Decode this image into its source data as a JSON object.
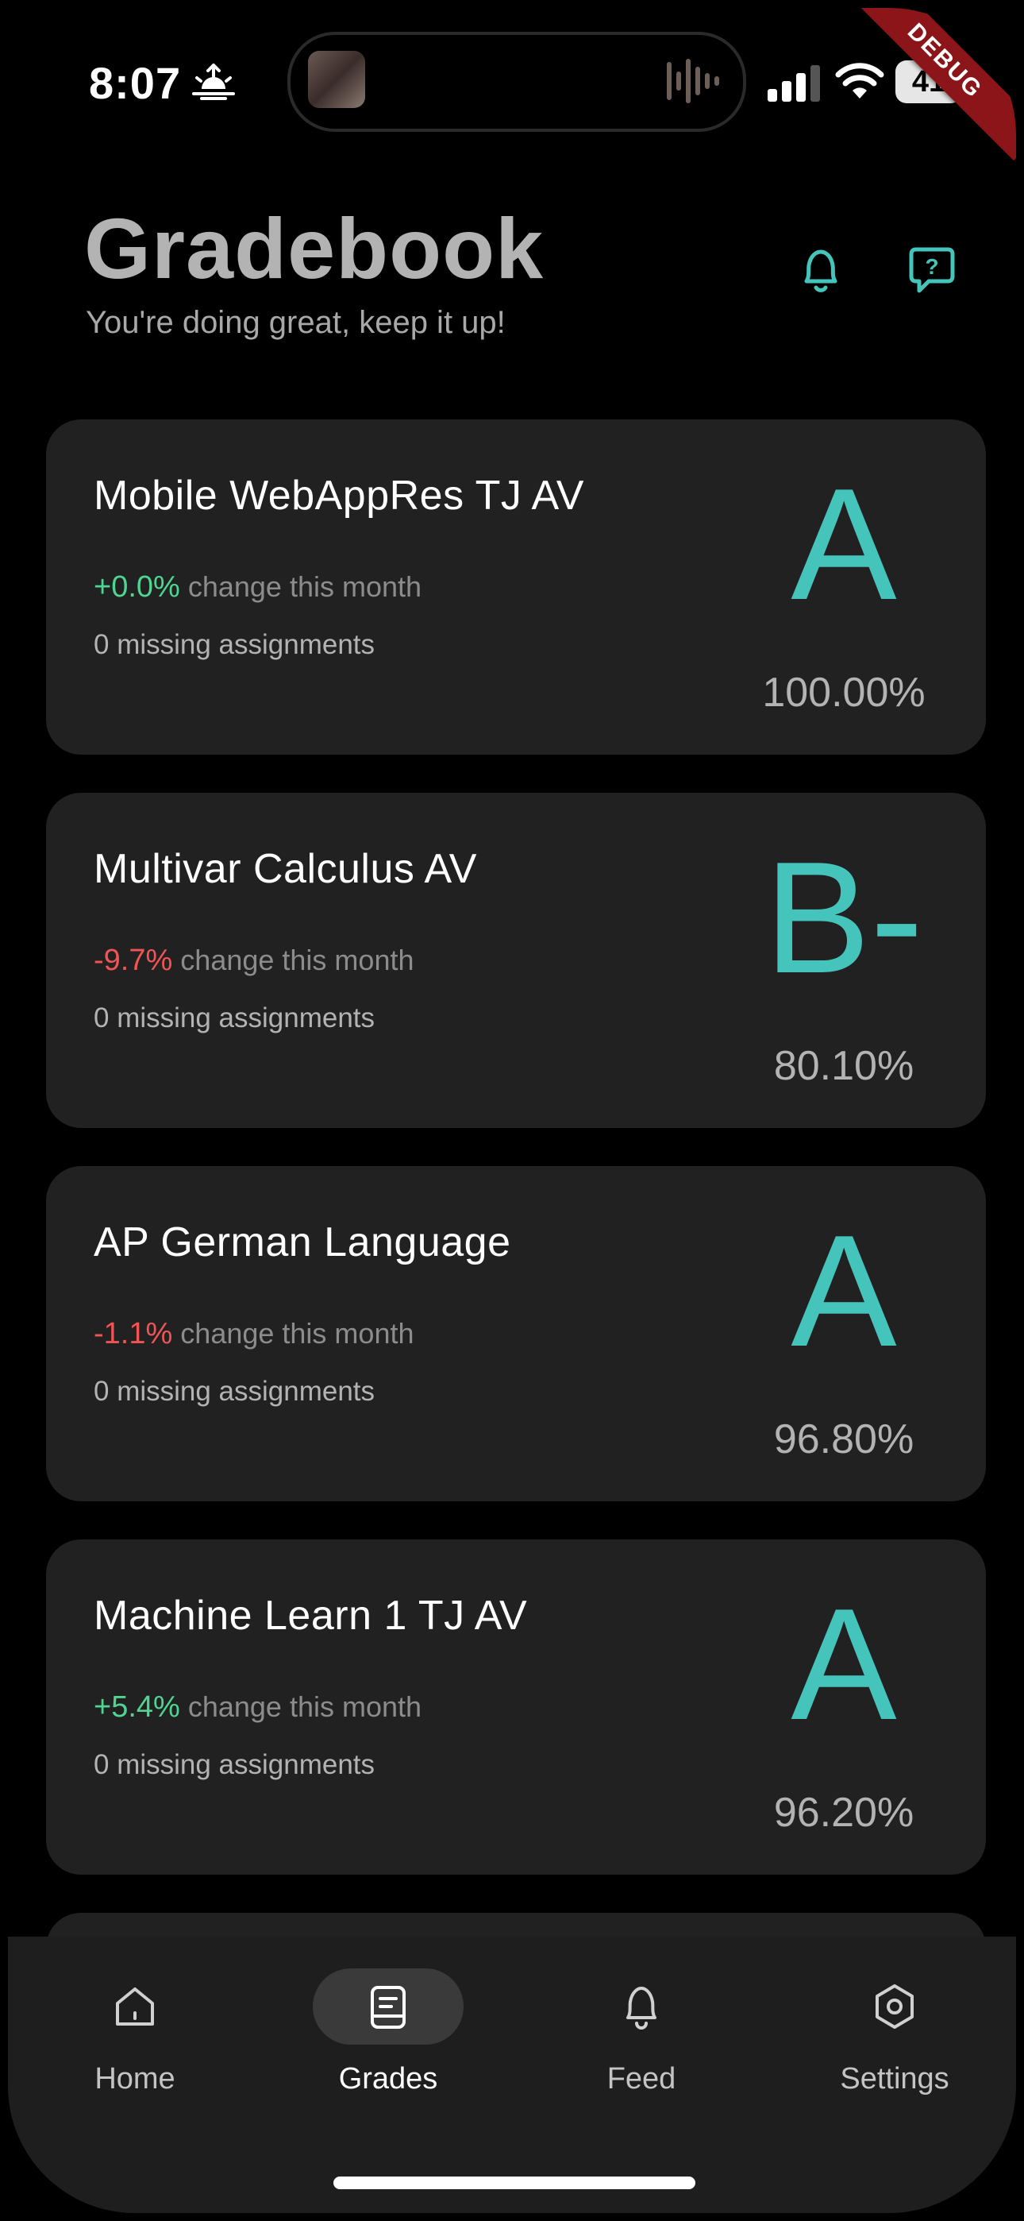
{
  "status_bar": {
    "time": "8:07",
    "battery": "41",
    "icons": [
      "sunrise-icon",
      "cellular-signal-icon",
      "wifi-icon",
      "battery-icon"
    ]
  },
  "debug_banner": "DEBUG",
  "header": {
    "title": "Gradebook",
    "subtitle": "You're doing great, keep it up!",
    "icons": [
      "bell-icon",
      "help-chat-icon"
    ],
    "accent_color": "#45c4bb"
  },
  "colors": {
    "accent": "#45c4bb",
    "positive": "#4fd591",
    "negative": "#f05454",
    "card_bg": "#212121",
    "nav_bg": "#1e1e1e"
  },
  "courses": [
    {
      "name": "Mobile WebAppRes TJ AV",
      "change": "+0.0%",
      "change_label": "change this month",
      "missing": "0 missing assignments",
      "letter": "A",
      "percent": "100.00%"
    },
    {
      "name": "Multivar Calculus AV",
      "change": "-9.7%",
      "change_label": "change this month",
      "missing": "0 missing assignments",
      "letter": "B-",
      "percent": "80.10%"
    },
    {
      "name": "AP German Language",
      "change": "-1.1%",
      "change_label": "change this month",
      "missing": "0 missing assignments",
      "letter": "A",
      "percent": "96.80%"
    },
    {
      "name": "Machine Learn 1 TJ AV",
      "change": "+5.4%",
      "change_label": "change this month",
      "missing": "0 missing assignments",
      "letter": "A",
      "percent": "96.20%"
    }
  ],
  "nav": {
    "items": [
      {
        "label": "Home",
        "icon": "home-icon",
        "active": false
      },
      {
        "label": "Grades",
        "icon": "gradebook-icon",
        "active": true
      },
      {
        "label": "Feed",
        "icon": "bell-icon",
        "active": false
      },
      {
        "label": "Settings",
        "icon": "settings-icon",
        "active": false
      }
    ]
  }
}
